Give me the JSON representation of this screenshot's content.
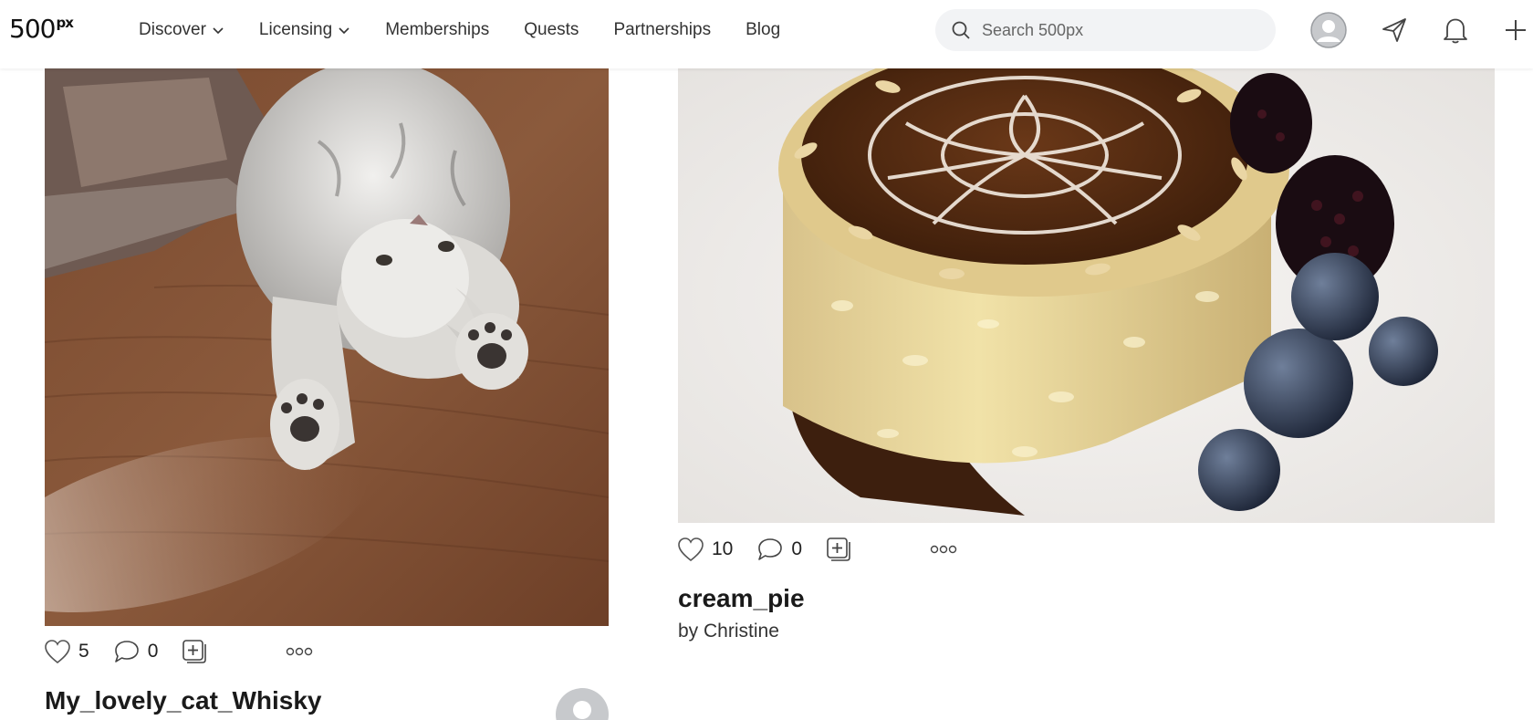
{
  "header": {
    "logo_main": "500",
    "logo_sup": "px",
    "nav": [
      {
        "label": "Discover",
        "dropdown": true
      },
      {
        "label": "Licensing",
        "dropdown": true
      },
      {
        "label": "Memberships",
        "dropdown": false
      },
      {
        "label": "Quests",
        "dropdown": false
      },
      {
        "label": "Partnerships",
        "dropdown": false
      },
      {
        "label": "Blog",
        "dropdown": false
      }
    ],
    "search": {
      "placeholder": "Search 500px",
      "value": ""
    },
    "icons": [
      "user-avatar-icon",
      "send-icon",
      "bell-icon",
      "plus-icon"
    ]
  },
  "cards": [
    {
      "image": "kitten lying upside down on wooden floor",
      "likes": "5",
      "comments": "0",
      "title": "My_lovely_cat_Whisky"
    },
    {
      "image": "cream pie with chocolate swirl topping and berries",
      "likes": "10",
      "comments": "0",
      "title": "cream_pie",
      "byline": "by Christine"
    }
  ],
  "colors": {
    "header_bg": "#ffffff",
    "search_bg": "#f2f3f5",
    "text": "#222222"
  }
}
